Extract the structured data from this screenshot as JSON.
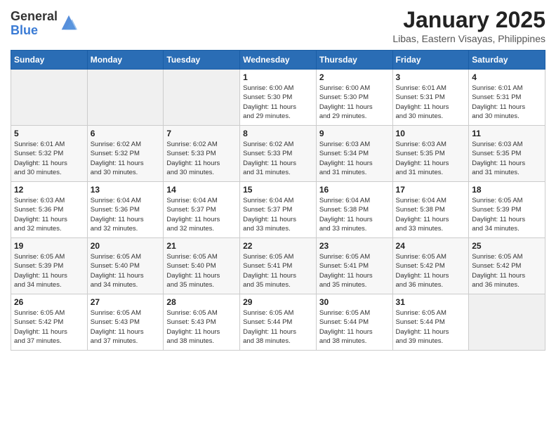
{
  "header": {
    "logo_general": "General",
    "logo_blue": "Blue",
    "month_year": "January 2025",
    "location": "Libas, Eastern Visayas, Philippines"
  },
  "weekdays": [
    "Sunday",
    "Monday",
    "Tuesday",
    "Wednesday",
    "Thursday",
    "Friday",
    "Saturday"
  ],
  "weeks": [
    [
      {
        "day": "",
        "info": ""
      },
      {
        "day": "",
        "info": ""
      },
      {
        "day": "",
        "info": ""
      },
      {
        "day": "1",
        "info": "Sunrise: 6:00 AM\nSunset: 5:30 PM\nDaylight: 11 hours\nand 29 minutes."
      },
      {
        "day": "2",
        "info": "Sunrise: 6:00 AM\nSunset: 5:30 PM\nDaylight: 11 hours\nand 29 minutes."
      },
      {
        "day": "3",
        "info": "Sunrise: 6:01 AM\nSunset: 5:31 PM\nDaylight: 11 hours\nand 30 minutes."
      },
      {
        "day": "4",
        "info": "Sunrise: 6:01 AM\nSunset: 5:31 PM\nDaylight: 11 hours\nand 30 minutes."
      }
    ],
    [
      {
        "day": "5",
        "info": "Sunrise: 6:01 AM\nSunset: 5:32 PM\nDaylight: 11 hours\nand 30 minutes."
      },
      {
        "day": "6",
        "info": "Sunrise: 6:02 AM\nSunset: 5:32 PM\nDaylight: 11 hours\nand 30 minutes."
      },
      {
        "day": "7",
        "info": "Sunrise: 6:02 AM\nSunset: 5:33 PM\nDaylight: 11 hours\nand 30 minutes."
      },
      {
        "day": "8",
        "info": "Sunrise: 6:02 AM\nSunset: 5:33 PM\nDaylight: 11 hours\nand 31 minutes."
      },
      {
        "day": "9",
        "info": "Sunrise: 6:03 AM\nSunset: 5:34 PM\nDaylight: 11 hours\nand 31 minutes."
      },
      {
        "day": "10",
        "info": "Sunrise: 6:03 AM\nSunset: 5:35 PM\nDaylight: 11 hours\nand 31 minutes."
      },
      {
        "day": "11",
        "info": "Sunrise: 6:03 AM\nSunset: 5:35 PM\nDaylight: 11 hours\nand 31 minutes."
      }
    ],
    [
      {
        "day": "12",
        "info": "Sunrise: 6:03 AM\nSunset: 5:36 PM\nDaylight: 11 hours\nand 32 minutes."
      },
      {
        "day": "13",
        "info": "Sunrise: 6:04 AM\nSunset: 5:36 PM\nDaylight: 11 hours\nand 32 minutes."
      },
      {
        "day": "14",
        "info": "Sunrise: 6:04 AM\nSunset: 5:37 PM\nDaylight: 11 hours\nand 32 minutes."
      },
      {
        "day": "15",
        "info": "Sunrise: 6:04 AM\nSunset: 5:37 PM\nDaylight: 11 hours\nand 33 minutes."
      },
      {
        "day": "16",
        "info": "Sunrise: 6:04 AM\nSunset: 5:38 PM\nDaylight: 11 hours\nand 33 minutes."
      },
      {
        "day": "17",
        "info": "Sunrise: 6:04 AM\nSunset: 5:38 PM\nDaylight: 11 hours\nand 33 minutes."
      },
      {
        "day": "18",
        "info": "Sunrise: 6:05 AM\nSunset: 5:39 PM\nDaylight: 11 hours\nand 34 minutes."
      }
    ],
    [
      {
        "day": "19",
        "info": "Sunrise: 6:05 AM\nSunset: 5:39 PM\nDaylight: 11 hours\nand 34 minutes."
      },
      {
        "day": "20",
        "info": "Sunrise: 6:05 AM\nSunset: 5:40 PM\nDaylight: 11 hours\nand 34 minutes."
      },
      {
        "day": "21",
        "info": "Sunrise: 6:05 AM\nSunset: 5:40 PM\nDaylight: 11 hours\nand 35 minutes."
      },
      {
        "day": "22",
        "info": "Sunrise: 6:05 AM\nSunset: 5:41 PM\nDaylight: 11 hours\nand 35 minutes."
      },
      {
        "day": "23",
        "info": "Sunrise: 6:05 AM\nSunset: 5:41 PM\nDaylight: 11 hours\nand 35 minutes."
      },
      {
        "day": "24",
        "info": "Sunrise: 6:05 AM\nSunset: 5:42 PM\nDaylight: 11 hours\nand 36 minutes."
      },
      {
        "day": "25",
        "info": "Sunrise: 6:05 AM\nSunset: 5:42 PM\nDaylight: 11 hours\nand 36 minutes."
      }
    ],
    [
      {
        "day": "26",
        "info": "Sunrise: 6:05 AM\nSunset: 5:42 PM\nDaylight: 11 hours\nand 37 minutes."
      },
      {
        "day": "27",
        "info": "Sunrise: 6:05 AM\nSunset: 5:43 PM\nDaylight: 11 hours\nand 37 minutes."
      },
      {
        "day": "28",
        "info": "Sunrise: 6:05 AM\nSunset: 5:43 PM\nDaylight: 11 hours\nand 38 minutes."
      },
      {
        "day": "29",
        "info": "Sunrise: 6:05 AM\nSunset: 5:44 PM\nDaylight: 11 hours\nand 38 minutes."
      },
      {
        "day": "30",
        "info": "Sunrise: 6:05 AM\nSunset: 5:44 PM\nDaylight: 11 hours\nand 38 minutes."
      },
      {
        "day": "31",
        "info": "Sunrise: 6:05 AM\nSunset: 5:44 PM\nDaylight: 11 hours\nand 39 minutes."
      },
      {
        "day": "",
        "info": ""
      }
    ]
  ]
}
